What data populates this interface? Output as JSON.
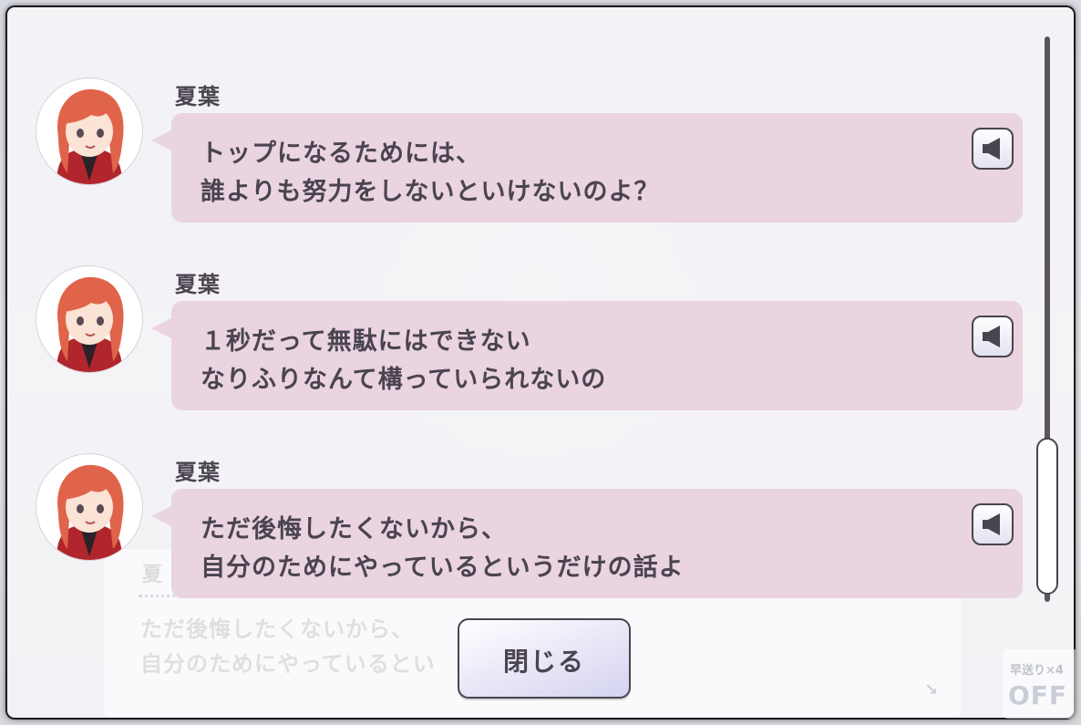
{
  "log": {
    "entries": [
      {
        "speaker": "夏葉",
        "line1": "トップになるためには、",
        "line2": "誰よりも努力をしないといけないのよ？"
      },
      {
        "speaker": "夏葉",
        "line1": "１秒だって無駄にはできない",
        "line2": "なりふりなんて構っていられないの"
      },
      {
        "speaker": "夏葉",
        "line1": "ただ後悔したくないから、",
        "line2": "自分のためにやっているというだけの話よ"
      }
    ],
    "close_label": "閉じる"
  },
  "background": {
    "ghost_line1": "ただ後悔したくないから、",
    "ghost_line2": "自分のためにやっているとい",
    "ghost_name": "夏",
    "fast_forward_label": "早送り×4",
    "fast_forward_state": "OFF"
  },
  "icons": {
    "voice": "speaker-icon",
    "ghost_next": "arrow-down-right-icon"
  },
  "colors": {
    "bubble": "#e9d4e0",
    "text": "#4a4450",
    "hair": "#e0644a"
  }
}
